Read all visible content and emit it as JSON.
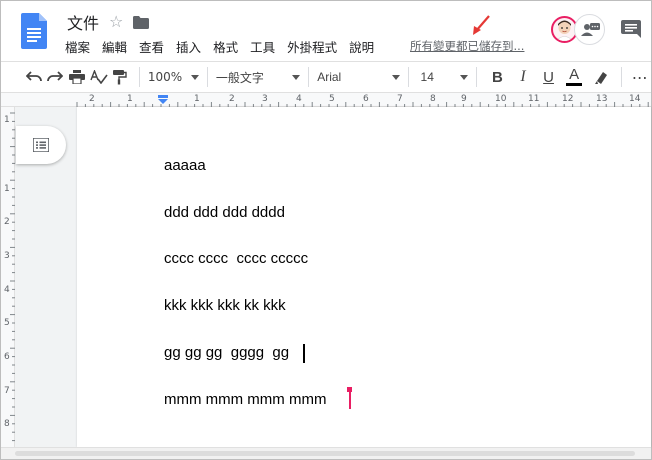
{
  "header": {
    "title": "文件",
    "menu": [
      "檔案",
      "編輯",
      "查看",
      "插入",
      "格式",
      "工具",
      "外掛程式",
      "說明"
    ],
    "save_status": "所有變更都已儲存到..."
  },
  "toolbar": {
    "zoom": "100%",
    "style": "一般文字",
    "font": "Arial",
    "size": "14"
  },
  "ruler": {
    "h_marks": [
      "2",
      "1",
      "1",
      "2",
      "3",
      "4",
      "5",
      "6",
      "7",
      "8",
      "9",
      "10",
      "11",
      "12",
      "13",
      "14"
    ],
    "v_marks": [
      "1",
      "1",
      "2",
      "3",
      "4",
      "5",
      "6",
      "7",
      "8"
    ]
  },
  "document": {
    "paragraphs": [
      "aaaaa",
      "ddd ddd ddd dddd",
      "cccc cccc  cccc ccccc",
      "kkk kkk kkk kk kkk",
      "gg gg gg  gggg  gg",
      "mmm mmm mmm mmm"
    ]
  },
  "colors": {
    "doc_blue": "#4285f4",
    "collaborator": "#e91e63",
    "arrow": "#e53935"
  }
}
